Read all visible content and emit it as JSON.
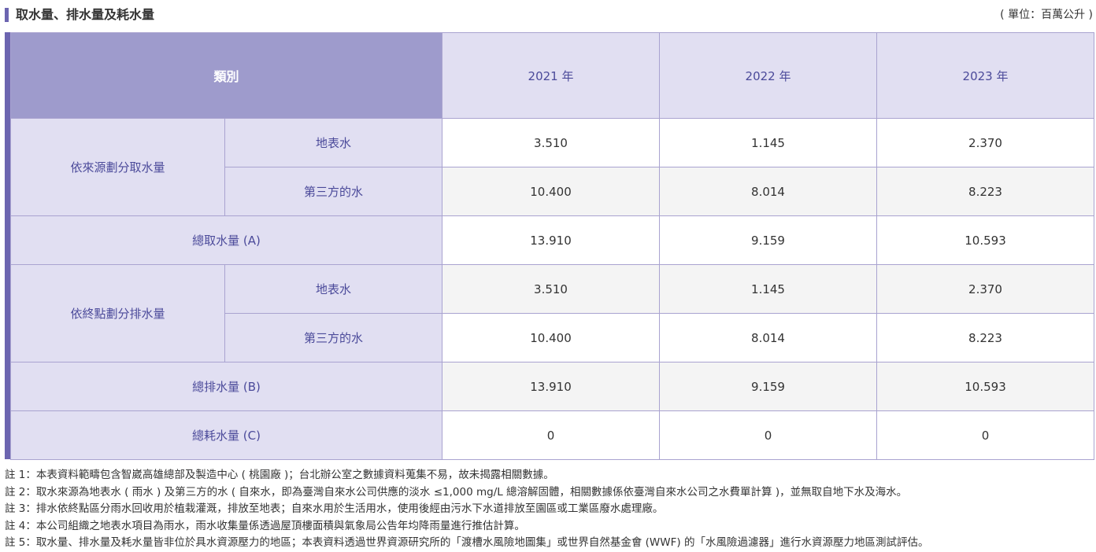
{
  "header": {
    "title": "取水量、排水量及耗水量",
    "unit": "( 單位：百萬公升 )"
  },
  "table": {
    "category_header": "類別",
    "years": [
      "2021 年",
      "2022 年",
      "2023 年"
    ],
    "groups": {
      "withdrawal_by_source": "依來源劃分取水量",
      "discharge_by_destination": "依終點劃分排水量"
    },
    "subs": {
      "surface_water": "地表水",
      "third_party_water": "第三方的水"
    },
    "rows": {
      "w_surface": [
        "3.510",
        "1.145",
        "2.370"
      ],
      "w_third": [
        "10.400",
        "8.014",
        "8.223"
      ],
      "total_withdrawal": {
        "label": "總取水量 (A)",
        "values": [
          "13.910",
          "9.159",
          "10.593"
        ]
      },
      "d_surface": [
        "3.510",
        "1.145",
        "2.370"
      ],
      "d_third": [
        "10.400",
        "8.014",
        "8.223"
      ],
      "total_discharge": {
        "label": "總排水量 (B)",
        "values": [
          "13.910",
          "9.159",
          "10.593"
        ]
      },
      "total_consumption": {
        "label": "總耗水量 (C)",
        "values": [
          "0",
          "0",
          "0"
        ]
      }
    }
  },
  "notes": [
    "註 1：本表資料範疇包含智崴高雄總部及製造中心 ( 桃園廠 )；台北辦公室之數據資料蒐集不易，故未揭露相關數據。",
    "註 2：取水來源為地表水 ( 雨水 ) 及第三方的水 ( 自來水，即為臺灣自來水公司供應的淡水 ≤1,000 mg/L 總溶解固體，相關數據係依臺灣自來水公司之水費單計算 )，並無取自地下水及海水。",
    "註 3：排水依終點區分雨水回收用於植栽灌溉，排放至地表；自來水用於生活用水，使用後經由污水下水道排放至園區或工業區廢水處理廠。",
    "註 4：本公司組織之地表水項目為雨水，雨水收集量係透過屋頂樓面積與氣象局公告年均降雨量進行推估計算。",
    "註 5：取水量、排水量及耗水量皆非位於具水資源壓力的地區；本表資料透過世界資源研究所的「渡槽水風險地圖集」或世界自然基金會 (WWF) 的「水風險過濾器」進行水資源壓力地區測試評估。"
  ]
}
